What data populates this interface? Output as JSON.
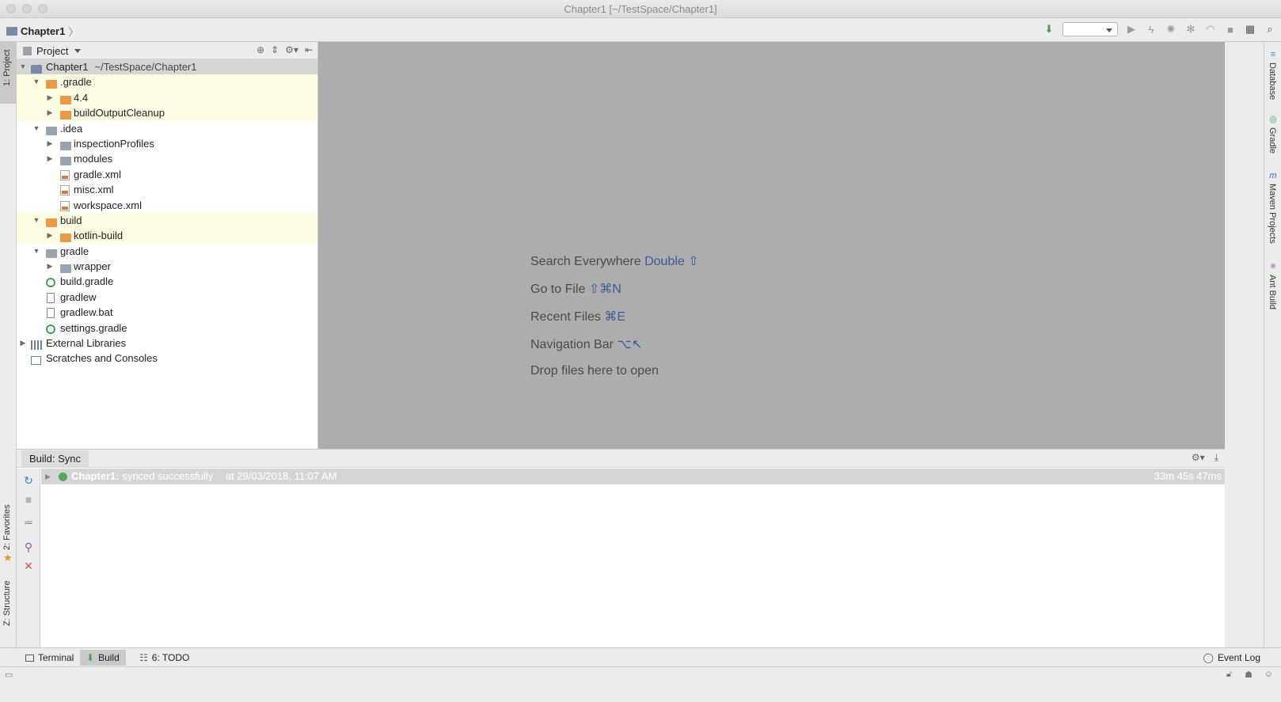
{
  "window": {
    "title": "Chapter1 [~/TestSpace/Chapter1]"
  },
  "navbar": {
    "breadcrumb": "Chapter1"
  },
  "left_stripe": {
    "project": "1: Project",
    "favorites": "2: Favorites",
    "structure": "Z: Structure"
  },
  "project_panel": {
    "view": "Project",
    "tree": [
      {
        "label": "Chapter1",
        "extra": "~/TestSpace/Chapter1",
        "icon": "module-folder-icon"
      },
      {
        "label": ".gradle",
        "icon": "folder-orange-icon"
      },
      {
        "label": "4.4",
        "icon": "folder-orange-icon"
      },
      {
        "label": "buildOutputCleanup",
        "icon": "folder-orange-icon"
      },
      {
        "label": ".idea",
        "icon": "folder-grey-icon"
      },
      {
        "label": "inspectionProfiles",
        "icon": "folder-grey-icon"
      },
      {
        "label": "modules",
        "icon": "folder-grey-icon"
      },
      {
        "label": "gradle.xml",
        "icon": "xml-file-icon"
      },
      {
        "label": "misc.xml",
        "icon": "xml-file-icon"
      },
      {
        "label": "workspace.xml",
        "icon": "xml-file-icon"
      },
      {
        "label": "build",
        "icon": "folder-orange-icon"
      },
      {
        "label": "kotlin-build",
        "icon": "folder-orange-icon"
      },
      {
        "label": "gradle",
        "icon": "folder-grey-icon"
      },
      {
        "label": "wrapper",
        "icon": "folder-grey-icon"
      },
      {
        "label": "build.gradle",
        "icon": "gradle-file-icon"
      },
      {
        "label": "gradlew",
        "icon": "file-icon"
      },
      {
        "label": "gradlew.bat",
        "icon": "file-icon"
      },
      {
        "label": "settings.gradle",
        "icon": "gradle-file-icon"
      },
      {
        "label": "External Libraries",
        "icon": "libraries-icon"
      },
      {
        "label": "Scratches and Consoles",
        "icon": "scratches-icon"
      }
    ]
  },
  "editor": {
    "hints": [
      {
        "text": "Search Everywhere",
        "key": "Double ⇧"
      },
      {
        "text": "Go to File",
        "key": "⇧⌘N"
      },
      {
        "text": "Recent Files",
        "key": "⌘E"
      },
      {
        "text": "Navigation Bar",
        "key": "⌥↖"
      },
      {
        "text": "Drop files here to open",
        "key": ""
      }
    ]
  },
  "right_stripe": {
    "database": "Database",
    "gradle": "Gradle",
    "maven": "Maven Projects",
    "ant": "Ant Build"
  },
  "build_panel": {
    "tab": "Build: Sync",
    "row": {
      "project": "Chapter1:",
      "message": "synced successfully",
      "at": "at 29/03/2018, 11:07 AM",
      "duration": "33m 45s 47ms"
    }
  },
  "bottom_bar": {
    "terminal": "Terminal",
    "build": "Build",
    "todo": "6: TODO",
    "event_log": "Event Log"
  },
  "colors": {
    "editor_bg": "#adadad",
    "highlight_row": "#fdfbe2",
    "hint_key": "#3d5a99",
    "success_green": "#5aa55a",
    "folder_orange": "#e89a4a"
  }
}
